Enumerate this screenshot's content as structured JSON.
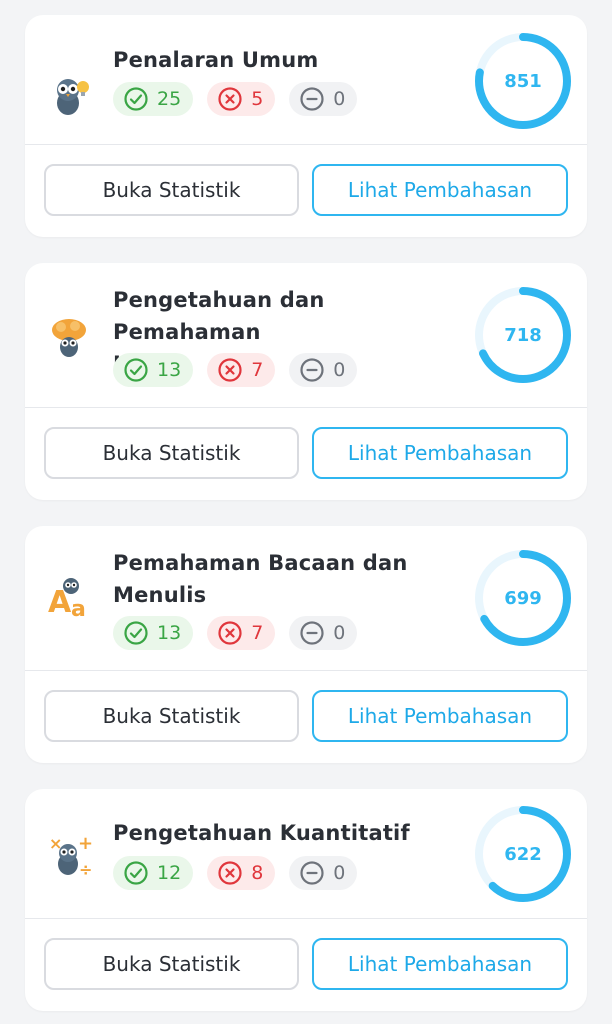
{
  "colors": {
    "accent": "#2fb6f0",
    "ring_track": "#e9f6fd",
    "correct": "#3aa545",
    "wrong": "#e0363c",
    "empty": "#6e737b"
  },
  "cards": [
    {
      "title_line1": "Penalaran Umum",
      "title_line2": "",
      "mascot_icon": "owl-lightbulb-icon",
      "correct": "25",
      "wrong": "5",
      "empty": "0",
      "score": "851",
      "progress": 0.78,
      "stat_button": "Buka Statistik",
      "review_button": "Lihat Pembahasan"
    },
    {
      "title_line1": "Pengetahuan dan Pemahaman",
      "title_line2": "Umum",
      "mascot_icon": "owl-brain-icon",
      "correct": "13",
      "wrong": "7",
      "empty": "0",
      "score": "718",
      "progress": 0.68,
      "stat_button": "Buka Statistik",
      "review_button": "Lihat Pembahasan"
    },
    {
      "title_line1": "Pemahaman Bacaan dan",
      "title_line2": "Menulis",
      "mascot_icon": "owl-letters-icon",
      "correct": "13",
      "wrong": "7",
      "empty": "0",
      "score": "699",
      "progress": 0.67,
      "stat_button": "Buka Statistik",
      "review_button": "Lihat Pembahasan"
    },
    {
      "title_line1": "Pengetahuan Kuantitatif",
      "title_line2": "",
      "mascot_icon": "owl-math-icon",
      "correct": "12",
      "wrong": "8",
      "empty": "0",
      "score": "622",
      "progress": 0.62,
      "stat_button": "Buka Statistik",
      "review_button": "Lihat Pembahasan"
    }
  ]
}
